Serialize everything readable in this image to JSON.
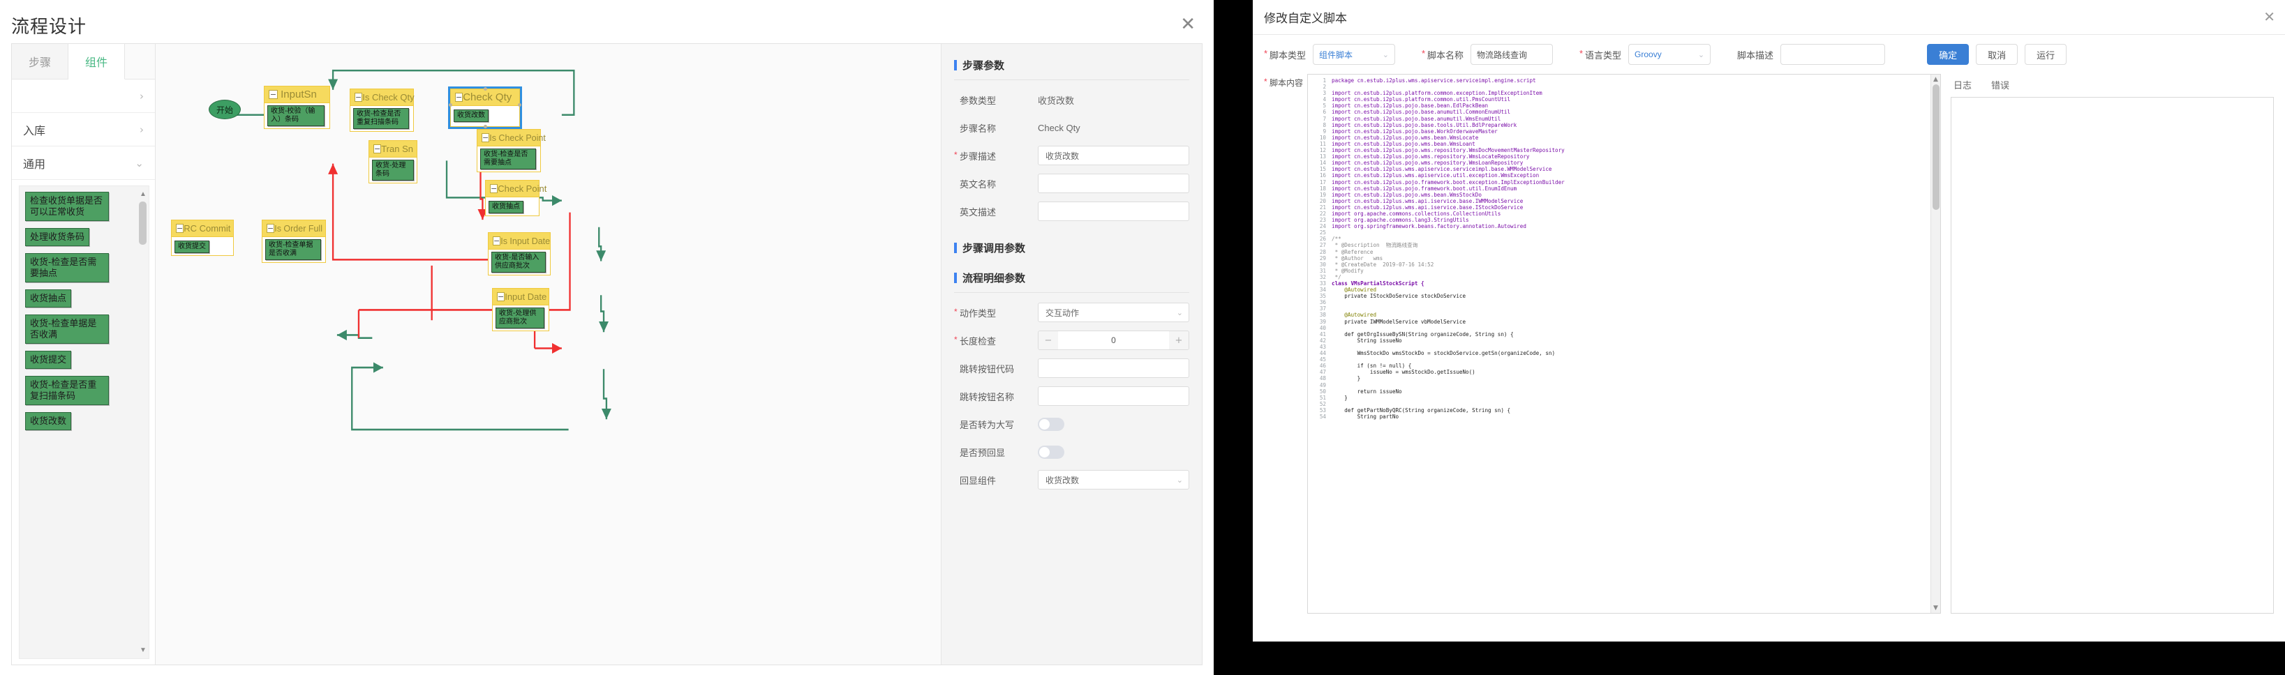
{
  "flow_window": {
    "title": "流程设计",
    "close_icon": "close-icon",
    "palette": {
      "tabs": [
        {
          "label": "步骤",
          "active": false
        },
        {
          "label": "组件",
          "active": true
        }
      ],
      "groups": [
        {
          "label": "",
          "chevron": "›"
        },
        {
          "label": "入库",
          "chevron": "›"
        },
        {
          "label": "通用",
          "chevron": "⌄"
        }
      ],
      "components": [
        "检查收货单据是否可以正常收货",
        "处理收货条码",
        "收货-检查是否需要抽点",
        "收货抽点",
        "收货-检查单据是否收满",
        "收货提交",
        "收货-检查是否重复扫描条码",
        "收货改数"
      ]
    },
    "canvas": {
      "start_label": "开始",
      "nodes": [
        {
          "id": "inputsn",
          "title": "InputSn",
          "chip": "收货-校验（输入）条码",
          "selected": false
        },
        {
          "id": "ischeckqty",
          "title": "Is Check Qty",
          "chip": "收货-检查是否重复扫描条码",
          "selected": false
        },
        {
          "id": "checkqty",
          "title": "Check Qty",
          "chip": "收货改数",
          "selected": true
        },
        {
          "id": "transn",
          "title": "Tran Sn",
          "chip": "收货-处理条码",
          "selected": false
        },
        {
          "id": "ischeckpoint",
          "title": "Is Check Point",
          "chip": "收货-检查是否需要抽点",
          "selected": false
        },
        {
          "id": "checkpoint",
          "title": "Check Point",
          "chip": "收货抽点",
          "selected": false
        },
        {
          "id": "isorderfull",
          "title": "Is Order Full",
          "chip": "收货-检查单据是否收满",
          "selected": false
        },
        {
          "id": "rccommit",
          "title": "RC Commit",
          "chip": "收货提交",
          "selected": false
        },
        {
          "id": "isinputdate",
          "title": "Is Input Date",
          "chip": "收货-是否输入供应商批次",
          "selected": false
        },
        {
          "id": "inputdate",
          "title": "Input Date",
          "chip": "收货-处理供应商批次",
          "selected": false
        }
      ],
      "collapse_glyph": "−",
      "edge_colors": {
        "flow": "#3c8a6a",
        "loop": "#f03030"
      }
    },
    "properties": {
      "section_step_params": "步骤参数",
      "section_call_params": "步骤调用参数",
      "section_detail_params": "流程明细参数",
      "fields": [
        {
          "label": "参数类型",
          "type": "text",
          "value": "收货改数",
          "required": false
        },
        {
          "label": "步骤名称",
          "type": "text",
          "value": "Check Qty",
          "required": false
        },
        {
          "label": "步骤描述",
          "type": "input",
          "value": "收货改数",
          "required": true
        },
        {
          "label": "英文名称",
          "type": "input",
          "value": "",
          "required": false
        },
        {
          "label": "英文描述",
          "type": "input",
          "value": "",
          "required": false
        }
      ],
      "detail_fields": [
        {
          "label": "动作类型",
          "type": "select",
          "value": "交互动作",
          "required": true
        },
        {
          "label": "长度检查",
          "type": "stepper",
          "value": "0",
          "minus": "−",
          "plus": "+",
          "required": true
        },
        {
          "label": "跳转按钮代码",
          "type": "input",
          "value": "",
          "required": false
        },
        {
          "label": "跳转按钮名称",
          "type": "input",
          "value": "",
          "required": false
        },
        {
          "label": "是否转为大写",
          "type": "toggle",
          "value": "off",
          "required": false
        },
        {
          "label": "是否预回显",
          "type": "toggle",
          "value": "off",
          "required": false
        },
        {
          "label": "回显组件",
          "type": "select",
          "value": "收货改数",
          "required": false
        }
      ]
    }
  },
  "script_window": {
    "title": "修改自定义脚本",
    "close_icon": "close-icon",
    "toolbar": {
      "script_type_label": "脚本类型",
      "script_type_value": "组件脚本",
      "script_name_label": "脚本名称",
      "script_name_value": "物流路线查询",
      "lang_type_label": "语言类型",
      "lang_type_value": "Groovy",
      "desc_label": "脚本描述",
      "desc_value": "",
      "buttons": [
        {
          "label": "确定",
          "kind": "primary"
        },
        {
          "label": "取消",
          "kind": "default"
        },
        {
          "label": "运行",
          "kind": "default"
        }
      ]
    },
    "editor": {
      "label": "脚本内容",
      "required": true,
      "lines": [
        {
          "n": 1,
          "t": "package cn.estub.i2plus.wms.apiservice.serviceimpl.engine.script",
          "c": "pkg"
        },
        {
          "n": 2,
          "t": "",
          "c": "plain"
        },
        {
          "n": 3,
          "t": "import cn.estub.i2plus.platform.common.exception.ImplExceptionItem",
          "c": "imp"
        },
        {
          "n": 4,
          "t": "import cn.estub.i2plus.platform.common.util.PmsCountUtil",
          "c": "imp"
        },
        {
          "n": 5,
          "t": "import cn.estub.i2plus.pojo.base.bean.EdlPackBean",
          "c": "imp"
        },
        {
          "n": 6,
          "t": "import cn.estub.i2plus.pojo.base.anumutil.CommonEnumUtil",
          "c": "imp"
        },
        {
          "n": 7,
          "t": "import cn.estub.i2plus.pojo.base.anumutil.WmsEnumUtil",
          "c": "imp"
        },
        {
          "n": 8,
          "t": "import cn.estub.i2plus.pojo.base.tools.Util.BdlPrepareWork",
          "c": "imp"
        },
        {
          "n": 9,
          "t": "import cn.estub.i2plus.pojo.base.WorkOrderwaveMaster",
          "c": "imp"
        },
        {
          "n": 10,
          "t": "import cn.estub.i2plus.pojo.wms.bean.WmsLocate",
          "c": "imp"
        },
        {
          "n": 11,
          "t": "import cn.estub.i2plus.pojo.wms.bean.WmsLoant",
          "c": "imp"
        },
        {
          "n": 12,
          "t": "import cn.estub.i2plus.pojo.wms.repository.WmsDocMovementMasterRepository",
          "c": "imp"
        },
        {
          "n": 13,
          "t": "import cn.estub.i2plus.pojo.wms.repository.WmsLocateRepository",
          "c": "imp"
        },
        {
          "n": 14,
          "t": "import cn.estub.i2plus.pojo.wms.repository.WmsLoanRepository",
          "c": "imp"
        },
        {
          "n": 15,
          "t": "import cn.estub.i2plus.wms.apiservice.serviceimpl.base.WMModelService",
          "c": "imp"
        },
        {
          "n": 16,
          "t": "import cn.estub.i2plus.wms.apiservice.util.exception.WmsException",
          "c": "imp"
        },
        {
          "n": 17,
          "t": "import cn.estub.i2plus.pojo.framework.boot.exception.ImplExceptionBuilder",
          "c": "imp"
        },
        {
          "n": 18,
          "t": "import cn.estub.i2plus.pojo.framework.boot.util.EnumIdEnum",
          "c": "imp"
        },
        {
          "n": 19,
          "t": "import cn.estub.i2plus.pojo.wms.bean.WmsStockDo",
          "c": "imp"
        },
        {
          "n": 20,
          "t": "import cn.estub.i2plus.wms.api.iservice.base.IWMModelService",
          "c": "imp"
        },
        {
          "n": 21,
          "t": "import cn.estub.i2plus.wms.api.iservice.base.IStockDoService",
          "c": "imp"
        },
        {
          "n": 22,
          "t": "import org.apache.commons.collections.CollectionUtils",
          "c": "imp"
        },
        {
          "n": 23,
          "t": "import org.apache.commons.lang3.StringUtils",
          "c": "imp"
        },
        {
          "n": 24,
          "t": "import org.springframework.beans.factory.annotation.Autowired",
          "c": "imp"
        },
        {
          "n": 25,
          "t": "",
          "c": "plain"
        },
        {
          "n": 26,
          "t": "/**",
          "c": "cmt"
        },
        {
          "n": 27,
          "t": " * @Description  物流路线查询",
          "c": "cmt"
        },
        {
          "n": 28,
          "t": " * @Reference",
          "c": "cmt"
        },
        {
          "n": 29,
          "t": " * @Author   wms",
          "c": "cmt"
        },
        {
          "n": 30,
          "t": " * @CreateDate  2019-07-16 14:52",
          "c": "cmt"
        },
        {
          "n": 31,
          "t": " * @Modify",
          "c": "cmt"
        },
        {
          "n": 32,
          "t": " */",
          "c": "cmt"
        },
        {
          "n": 33,
          "t": "class VMsPartialStockScript {",
          "c": "cls"
        },
        {
          "n": 34,
          "t": "    @Autowired",
          "c": "ann"
        },
        {
          "n": 35,
          "t": "    private IStockDoService stockDoService",
          "c": "code"
        },
        {
          "n": 36,
          "t": "",
          "c": "plain"
        },
        {
          "n": 37,
          "t": "",
          "c": "plain"
        },
        {
          "n": 38,
          "t": "    @Autowired",
          "c": "ann"
        },
        {
          "n": 39,
          "t": "    private IWMModelService vbModelService",
          "c": "code"
        },
        {
          "n": 40,
          "t": "",
          "c": "plain"
        },
        {
          "n": 41,
          "t": "    def getOrgIssueBySN(String organizeCode, String sn) {",
          "c": "code"
        },
        {
          "n": 42,
          "t": "        String issueNo",
          "c": "code"
        },
        {
          "n": 43,
          "t": "",
          "c": "plain"
        },
        {
          "n": 44,
          "t": "        WmsStockDo wmsStockDo = stockDoService.getSn(organizeCode, sn)",
          "c": "code"
        },
        {
          "n": 45,
          "t": "",
          "c": "plain"
        },
        {
          "n": 46,
          "t": "        if (sn != null) {",
          "c": "code"
        },
        {
          "n": 47,
          "t": "            issueNo = wmsStockDo.getIssueNo()",
          "c": "code"
        },
        {
          "n": 48,
          "t": "        }",
          "c": "code"
        },
        {
          "n": 49,
          "t": "",
          "c": "plain"
        },
        {
          "n": 50,
          "t": "        return issueNo",
          "c": "code"
        },
        {
          "n": 51,
          "t": "    }",
          "c": "code"
        },
        {
          "n": 52,
          "t": "",
          "c": "plain"
        },
        {
          "n": 53,
          "t": "    def getPartNoByQRC(String organizeCode, String sn) {",
          "c": "code"
        },
        {
          "n": 54,
          "t": "        String partNo",
          "c": "code"
        }
      ]
    },
    "log": {
      "tabs": [
        {
          "label": "日志",
          "active": true
        },
        {
          "label": "错误",
          "active": false
        }
      ]
    }
  }
}
